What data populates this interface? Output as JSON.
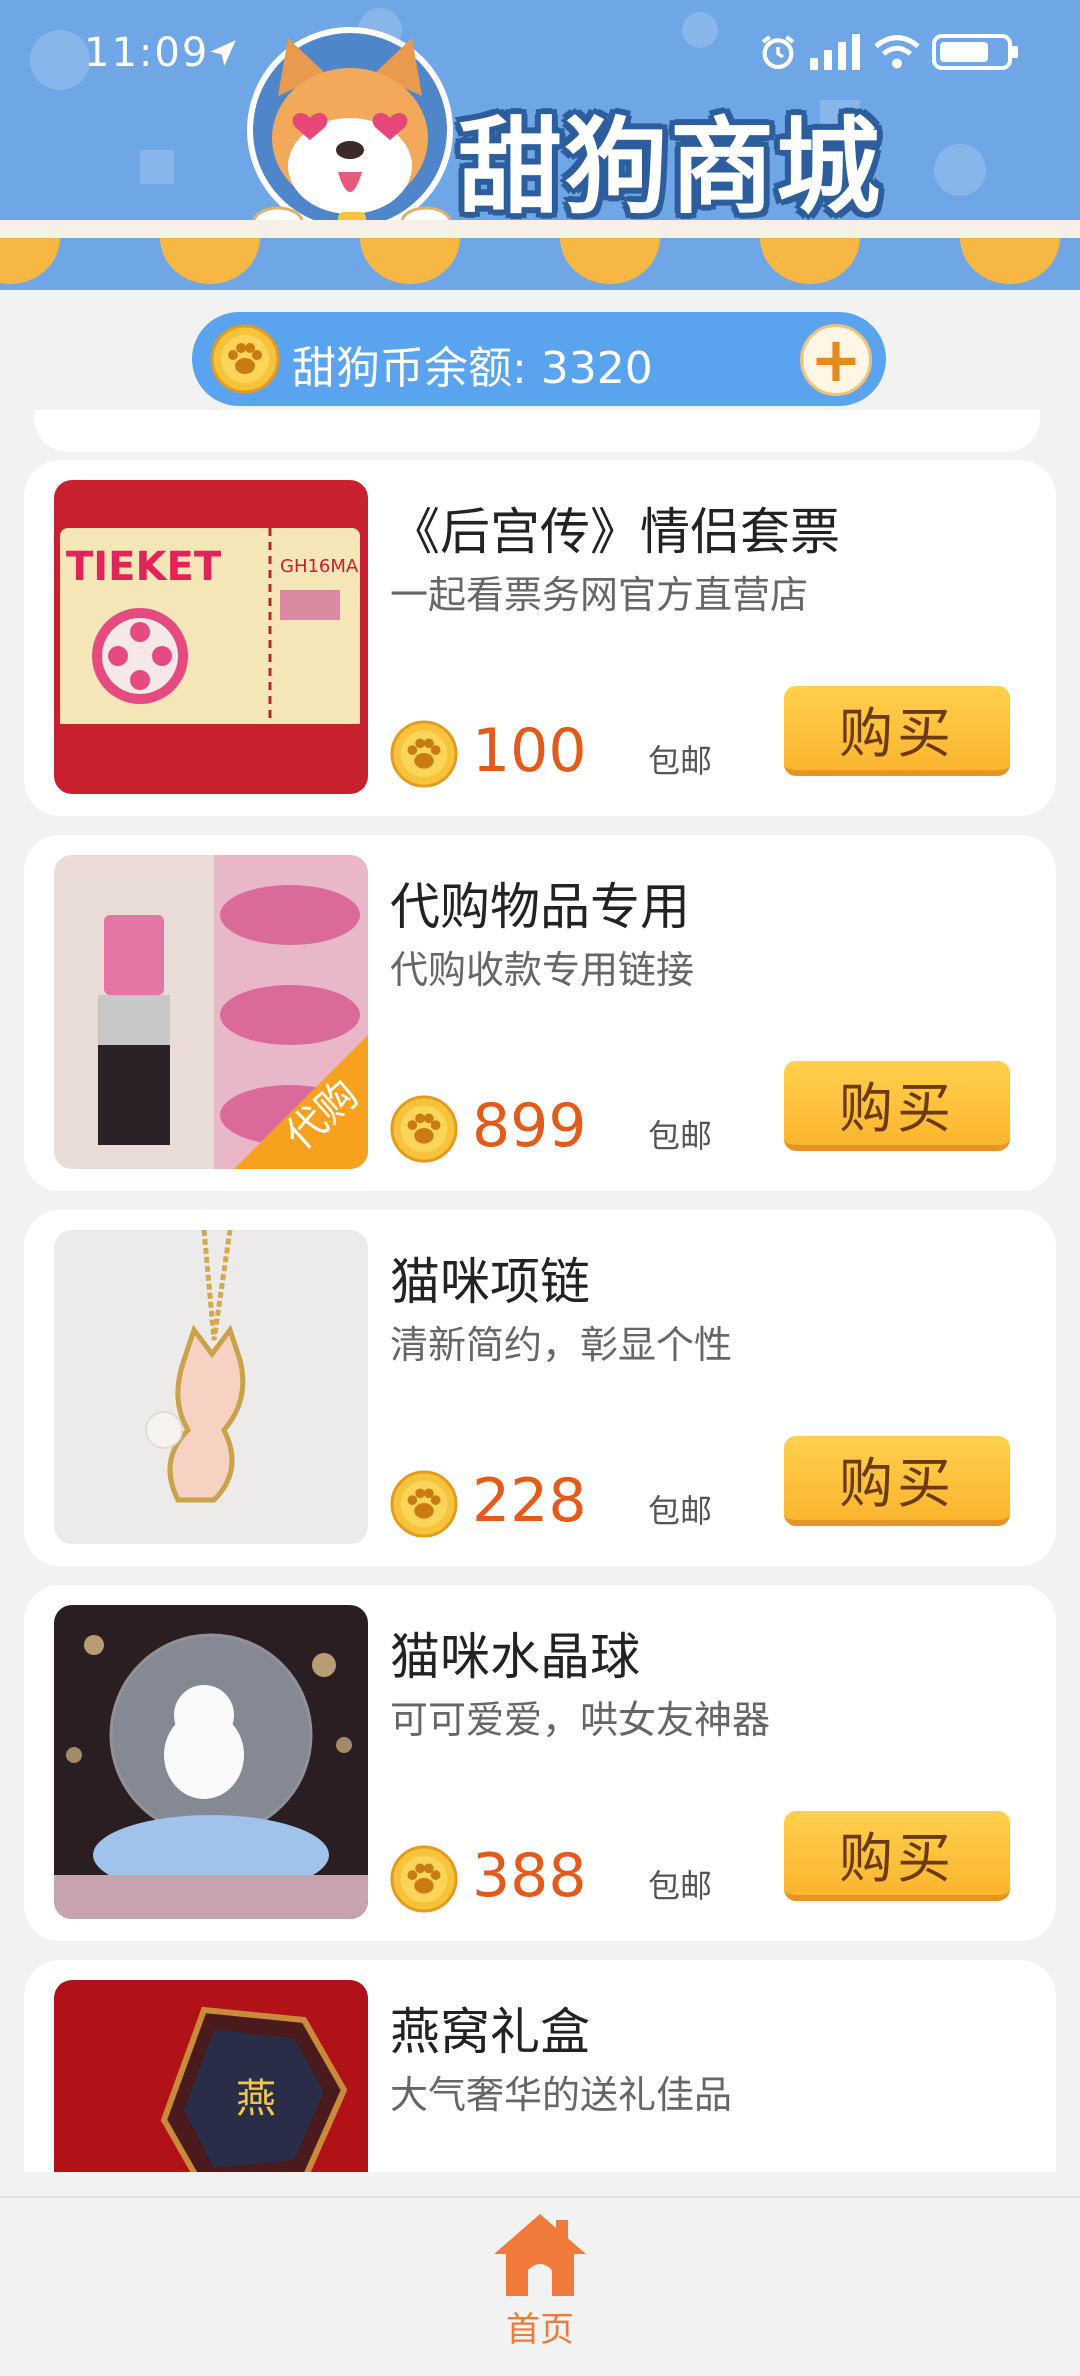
{
  "status": {
    "time": "11:09"
  },
  "header": {
    "title": "甜狗商城"
  },
  "balance": {
    "label": "甜狗币余额: 3320",
    "add_icon": "plus-icon"
  },
  "products": [
    {
      "name": "《后宫传》情侣套票",
      "desc": "一起看票务网官方直营店",
      "price": "100",
      "shipping": "包邮",
      "buy_label": "购买",
      "thumb_text": "TIEKET",
      "thumb_text2": "GH16MA"
    },
    {
      "name": "代购物品专用",
      "desc": "代购收款专用链接",
      "price": "899",
      "shipping": "包邮",
      "buy_label": "购买",
      "badge": "代购"
    },
    {
      "name": "猫咪项链",
      "desc": "清新简约，彰显个性",
      "price": "228",
      "shipping": "包邮",
      "buy_label": "购买"
    },
    {
      "name": "猫咪水晶球",
      "desc": "可可爱爱，哄女友神器",
      "price": "388",
      "shipping": "包邮",
      "buy_label": "购买"
    },
    {
      "name": "燕窝礼盒",
      "desc": "大气奢华的送礼佳品",
      "thumb_text": "燕"
    }
  ],
  "nav": {
    "home_label": "首页"
  },
  "colors": {
    "header_blue": "#6ea6e6",
    "price_orange": "#e35a1a",
    "buy_yellow": "#fbb52f",
    "nav_orange": "#f07a3a"
  }
}
